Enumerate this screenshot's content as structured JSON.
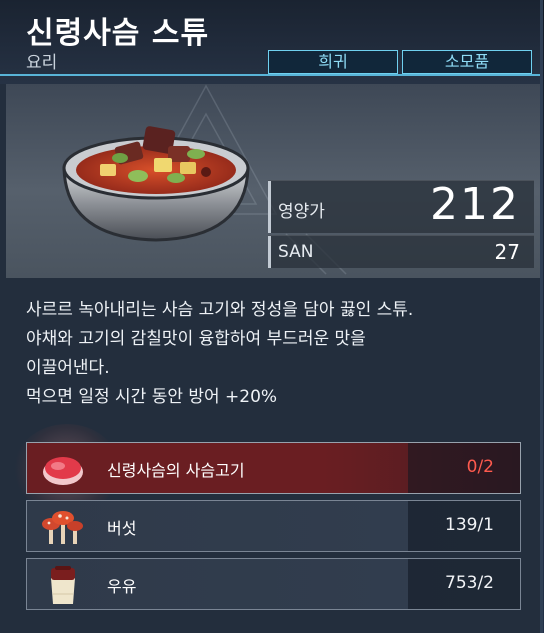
{
  "header": {
    "title": "신령사슴 스튜",
    "subtitle": "요리",
    "rarity_tag": "희귀",
    "type_tag": "소모품"
  },
  "stats": {
    "nutrition_label": "영양가",
    "nutrition_value": "212",
    "san_label": "SAN",
    "san_value": "27"
  },
  "description": {
    "lines": [
      "사르르 녹아내리는 사슴 고기와 정성을 담아 끓인 스튜.",
      "야채와 고기의 감칠맛이 융합하여 부드러운 맛을",
      "이끌어낸다.",
      "먹으면 일정 시간 동안 방어 +20%"
    ]
  },
  "ingredients": [
    {
      "name": "신령사슴의 사슴고기",
      "qty": "0/2",
      "icon": "deer-meat-icon",
      "lacking": true
    },
    {
      "name": "버섯",
      "qty": "139/1",
      "icon": "mushroom-icon",
      "lacking": false
    },
    {
      "name": "우유",
      "qty": "753/2",
      "icon": "milk-jar-icon",
      "lacking": false
    }
  ],
  "colors": {
    "accent": "#6fd0ef",
    "lacking": "#ff5a4e",
    "lacking_row": "#6a1e22"
  }
}
